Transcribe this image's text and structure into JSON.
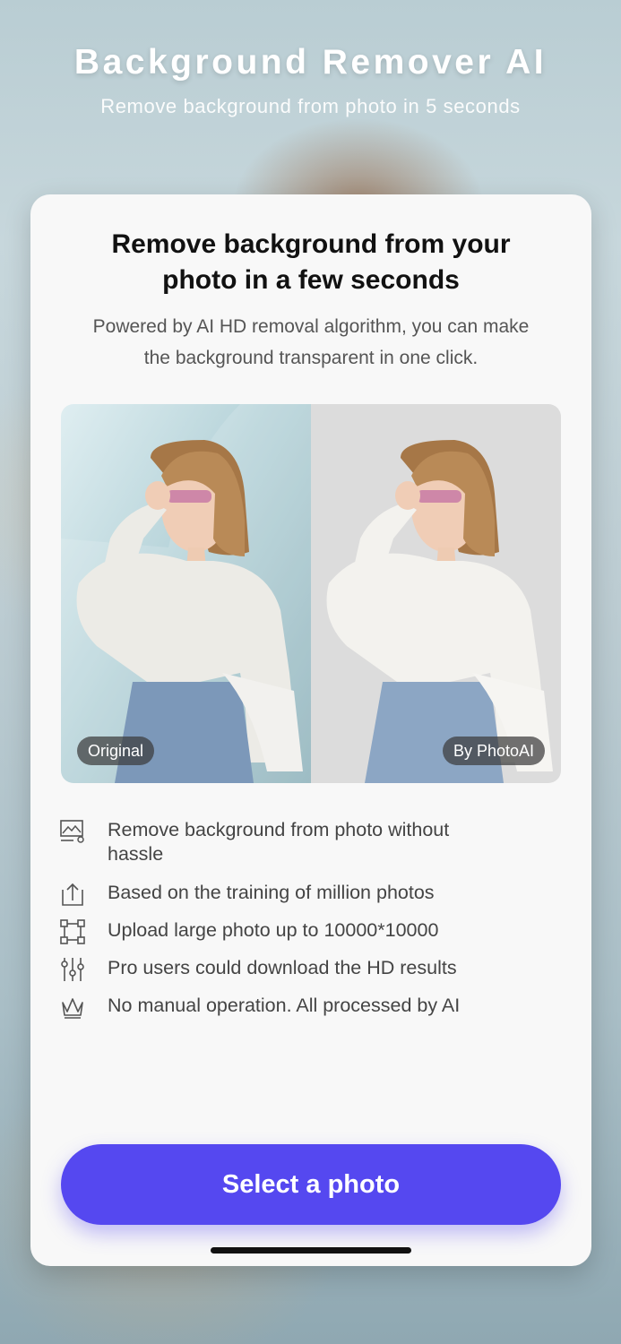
{
  "header": {
    "title": "Background Remover AI",
    "subtitle": "Remove background from photo in 5 seconds"
  },
  "card": {
    "title_line1": "Remove background from your",
    "title_line2": "photo in a few seconds",
    "desc_line1": "Powered by AI HD removal algorithm, you can make",
    "desc_line2": "the background transparent in one click."
  },
  "comparison": {
    "original_label": "Original",
    "processed_label": "By PhotoAI"
  },
  "features": [
    {
      "icon": "image-settings-icon",
      "line1": "Remove background from photo without",
      "line2": "hassle"
    },
    {
      "icon": "upload-icon",
      "line1": "Based on the training of million photos"
    },
    {
      "icon": "resize-frame-icon",
      "line1": "Upload large photo up to 10000*10000"
    },
    {
      "icon": "sliders-icon",
      "line1": "Pro users could download the HD results"
    },
    {
      "icon": "crown-icon",
      "line1": "No manual operation. All processed by AI"
    }
  ],
  "cta": {
    "label": "Select a photo"
  },
  "colors": {
    "accent": "#5548f0",
    "card": "#f8f8f8",
    "pill": "#3c3c3c"
  }
}
